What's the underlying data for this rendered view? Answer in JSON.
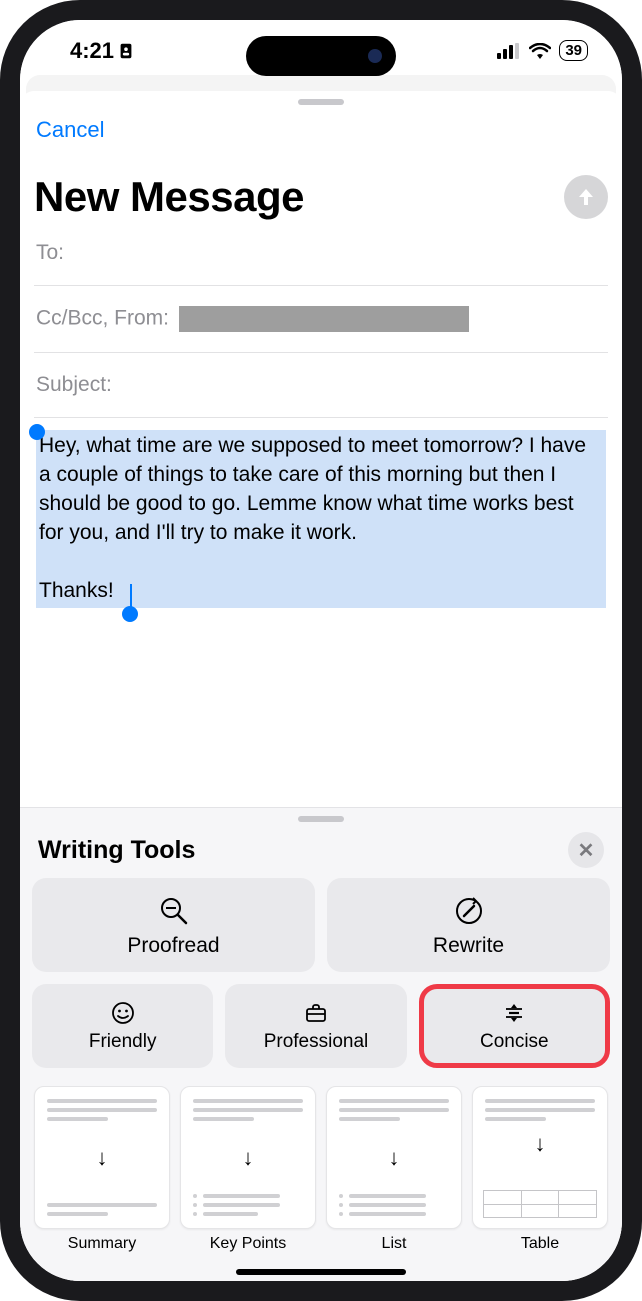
{
  "status": {
    "time": "4:21",
    "battery": "39"
  },
  "compose": {
    "cancel": "Cancel",
    "title": "New Message",
    "to_label": "To:",
    "ccbcc_label": "Cc/Bcc, From:",
    "subject_label": "Subject:",
    "body_text": "Hey, what time are we supposed to meet tomorrow? I have a couple of things to take care of this morning but then I should be good to go. Lemme know what time works best for you, and I'll try to make it work.",
    "body_signoff": "Thanks!"
  },
  "writing_tools": {
    "title": "Writing Tools",
    "proofread": "Proofread",
    "rewrite": "Rewrite",
    "friendly": "Friendly",
    "professional": "Professional",
    "concise": "Concise",
    "summary": "Summary",
    "key_points": "Key Points",
    "list": "List",
    "table": "Table"
  }
}
